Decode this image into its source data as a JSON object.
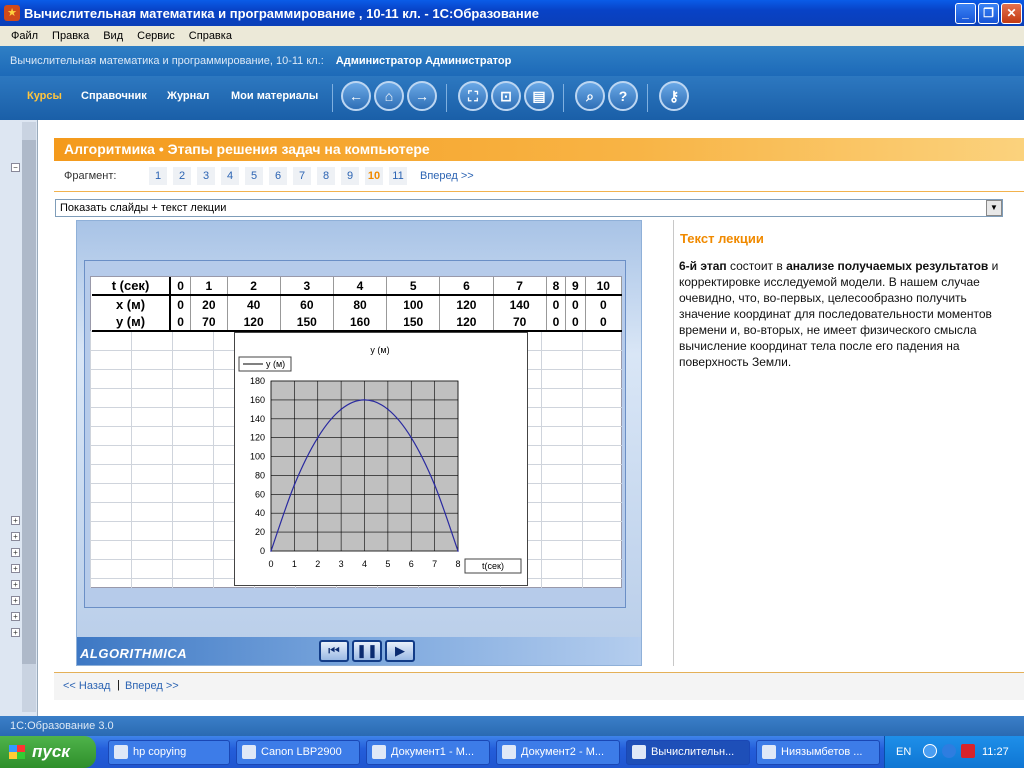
{
  "window": {
    "title": "Вычислительная математика и программирование , 10-11 кл. - 1С:Образование"
  },
  "menu": [
    "Файл",
    "Правка",
    "Вид",
    "Сервис",
    "Справка"
  ],
  "path": {
    "course": "Вычислительная математика и программирование, 10-11 кл.:",
    "user": "Администратор Администратор"
  },
  "nav": {
    "courses": "Курсы",
    "reference": "Справочник",
    "journal": "Журнал",
    "materials": "Мои материалы"
  },
  "page": {
    "title": "Алгоритмика • Этапы решения задач на компьютере",
    "fragment_label": "Фрагмент:",
    "fragments": [
      "1",
      "2",
      "3",
      "4",
      "5",
      "6",
      "7",
      "8",
      "9",
      "10",
      "11"
    ],
    "active_fragment": "10",
    "forward": "Вперед >>",
    "mode": "Показать слайды + текст лекции"
  },
  "table": {
    "rows": [
      [
        "t (сек)",
        "0",
        "1",
        "2",
        "3",
        "4",
        "5",
        "6",
        "7",
        "8",
        "9",
        "10"
      ],
      [
        "x (м)",
        "0",
        "20",
        "40",
        "60",
        "80",
        "100",
        "120",
        "140",
        "0",
        "0",
        "0"
      ],
      [
        "y (м)",
        "0",
        "70",
        "120",
        "150",
        "160",
        "150",
        "120",
        "70",
        "0",
        "0",
        "0"
      ]
    ]
  },
  "chart_data": {
    "type": "line",
    "title": "y (м)",
    "xlabel": "t(сек)",
    "ylabel": "",
    "x": [
      0,
      1,
      2,
      3,
      4,
      5,
      6,
      7,
      8
    ],
    "series": [
      {
        "name": "y (м)",
        "values": [
          0,
          70,
          120,
          150,
          160,
          150,
          120,
          70,
          0
        ]
      }
    ],
    "xlim": [
      0,
      8
    ],
    "ylim": [
      0,
      180
    ],
    "yticks": [
      0,
      20,
      40,
      60,
      80,
      100,
      120,
      140,
      160,
      180
    ],
    "xticks": [
      0,
      1,
      2,
      3,
      4,
      5,
      6,
      7,
      8
    ],
    "grid": true,
    "legend": "top-left"
  },
  "slide": {
    "logo": "ALGORITHMICA"
  },
  "lecture": {
    "heading": "Текст лекции",
    "t1": "6-й этап",
    "t2": " состоит в ",
    "t3": "анализе получаемых результатов",
    "t4": " и корректировке исследуемой модели. В нашем случае очевидно, что, во-первых, целесообразно получить значение координат для последовательности моментов времени и, во-вторых, не имеет физического смысла вычисление координат тела после его падения на поверхность Земли."
  },
  "bottom": {
    "prev": "<< Назад",
    "sep": "|",
    "next": "Вперед >>"
  },
  "status": "1С:Образование 3.0",
  "taskbar": {
    "start": "пуск",
    "tasks": [
      "hp copying",
      "Canon LBP2900",
      "Документ1 - М...",
      "Документ2 - М...",
      "Вычислительн...",
      "Ниязымбетов ..."
    ],
    "lang": "EN",
    "clock": "11:27"
  },
  "colors": {
    "accent": "#f49a1c",
    "nav": "#1a5fa8",
    "link": "#2c64b3"
  }
}
